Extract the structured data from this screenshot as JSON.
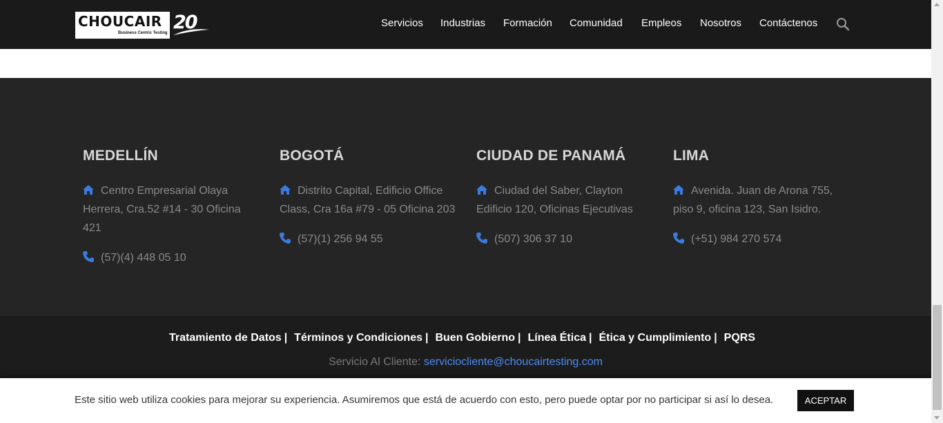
{
  "header": {
    "logo_text": "CHOUCAIR",
    "logo_tagline": "Business Centric Testing",
    "logo_anniversary": "20",
    "nav": [
      {
        "label": "Servicios"
      },
      {
        "label": "Industrias"
      },
      {
        "label": "Formación"
      },
      {
        "label": "Comunidad"
      },
      {
        "label": "Empleos"
      },
      {
        "label": "Nosotros"
      },
      {
        "label": "Contáctenos"
      }
    ],
    "search_icon": "search-icon"
  },
  "offices": [
    {
      "city": "MEDELLÍN",
      "address": "Centro Empresarial Olaya Herrera, Cra.52 #14 - 30 Oficina 421",
      "phone": "(57)(4) 448 05 10"
    },
    {
      "city": "BOGOTÁ",
      "address": "Distrito Capital, Edificio Office Class, Cra 16a #79 - 05 Oficina 203",
      "phone": "(57)(1) 256 94 55"
    },
    {
      "city": "CIUDAD DE PANAMÁ",
      "address": "Ciudad del Saber, Clayton Edificio 120, Oficinas Ejecutivas",
      "phone": "(507) 306 37 10"
    },
    {
      "city": "LIMA",
      "address": "Avenida. Juan de Arona 755, piso 9, oficina 123, San Isidro.",
      "phone": "(+51) 984 270 574"
    }
  ],
  "legal": {
    "links": [
      "Tratamiento de Datos",
      "Términos y Condiciones",
      "Buen Gobierno",
      "Línea Ética",
      "Ética y Cumplimiento",
      "PQRS"
    ],
    "separator": "|",
    "service_label": "Servicio Al Cliente:",
    "service_email": "serviciocliente@choucairtesting.com"
  },
  "cookie": {
    "text": "Este sitio web utiliza cookies para mejorar su experiencia. Asumiremos que está de acuerdo con esto, pero puede optar por no participar si así lo desea.",
    "button": "ACEPTAR"
  },
  "colors": {
    "header_bg": "#1a1a1a",
    "footer_bg": "#252525",
    "icon_blue": "#3b7be0",
    "link_blue": "#4d8cf5"
  }
}
